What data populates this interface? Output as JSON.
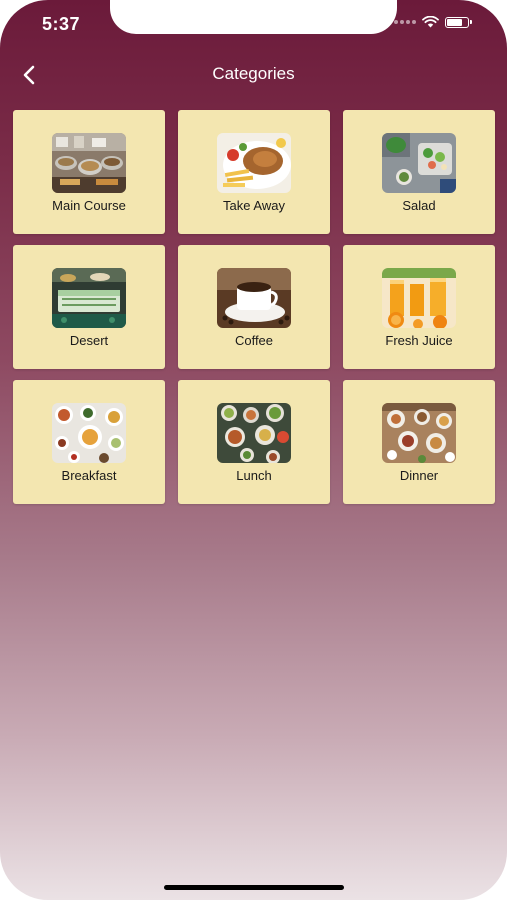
{
  "status_bar": {
    "time": "5:37"
  },
  "header": {
    "title": "Categories",
    "back_icon": "chevron-left-icon"
  },
  "colors": {
    "header_top": "#6b1a3a",
    "gradient_bottom": "#ebe2e5",
    "card_background": "#f3e6b0",
    "title_text": "#ffffff"
  },
  "categories": [
    {
      "label": "Main Course",
      "image": "buffet-dishes-photo"
    },
    {
      "label": "Take Away",
      "image": "shawarma-plate-photo"
    },
    {
      "label": "Salad",
      "image": "salad-bowl-photo"
    },
    {
      "label": "Desert",
      "image": "cake-photo"
    },
    {
      "label": "Coffee",
      "image": "coffee-cup-photo"
    },
    {
      "label": "Fresh Juice",
      "image": "orange-juice-photo"
    },
    {
      "label": "Breakfast",
      "image": "breakfast-spread-photo"
    },
    {
      "label": "Lunch",
      "image": "lunch-table-photo"
    },
    {
      "label": "Dinner",
      "image": "dinner-table-photo"
    }
  ]
}
